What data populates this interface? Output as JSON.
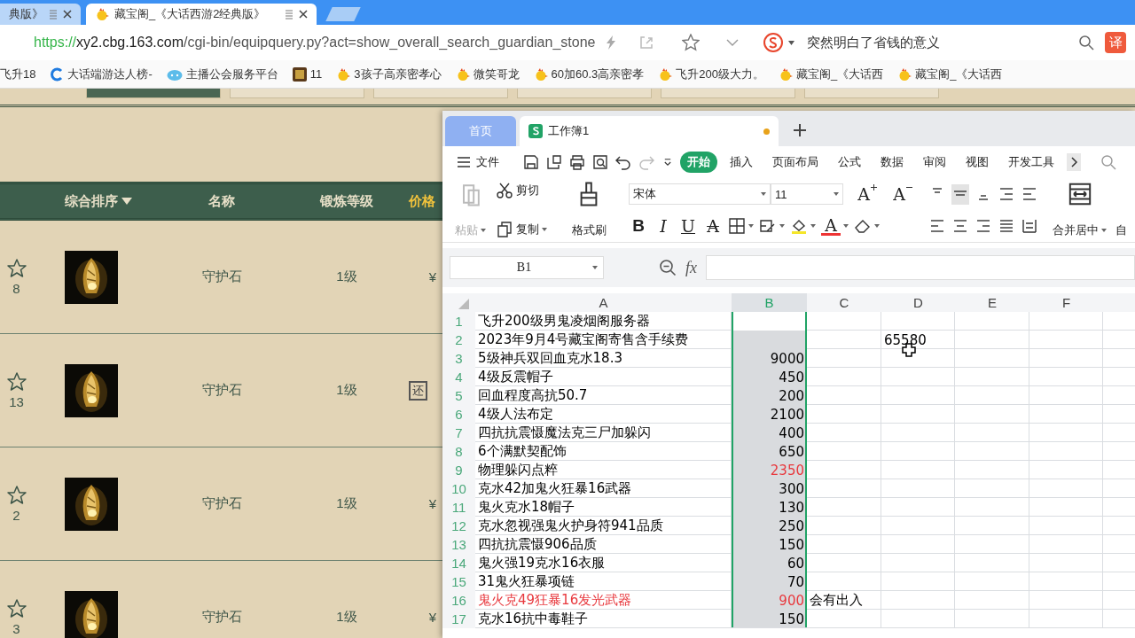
{
  "browser": {
    "tabs": [
      {
        "title": "典版》",
        "selected": false
      },
      {
        "title": "藏宝阁_《大话西游2经典版》",
        "selected": true
      }
    ],
    "address": {
      "scheme": "https://",
      "host": "xy2.cbg.163.com",
      "path": "/cgi-bin/equipquery.py?act=show_overall_search_guardian_stone"
    },
    "search": {
      "value": "突然明白了省钱的意义"
    },
    "translate_button": "译",
    "bookmarks": [
      {
        "label": "飞升18",
        "kind": "none"
      },
      {
        "label": "大话端游达人榜-",
        "kind": "c"
      },
      {
        "label": "主播公会服务平台",
        "kind": "cloud"
      },
      {
        "label": "11",
        "kind": "game"
      },
      {
        "label": "3孩子高亲密孝心",
        "kind": "chick"
      },
      {
        "label": "微笑哥龙",
        "kind": "chick"
      },
      {
        "label": "60加60.3高亲密孝",
        "kind": "chick"
      },
      {
        "label": "飞升200级大力。",
        "kind": "chick"
      },
      {
        "label": "藏宝阁_《大话西",
        "kind": "chick"
      },
      {
        "label": "藏宝阁_《大话西",
        "kind": "chick"
      }
    ]
  },
  "page": {
    "filter_buttons": [
      {
        "selected": true
      },
      {
        "selected": false
      },
      {
        "selected": false
      },
      {
        "selected": false
      },
      {
        "selected": false
      },
      {
        "selected": false
      }
    ],
    "columns": [
      {
        "label": "综合排序",
        "kind": "sort"
      },
      {
        "label": "名称",
        "kind": "plain"
      },
      {
        "label": "锻炼等级",
        "kind": "plain"
      },
      {
        "label": "价格",
        "kind": "price"
      }
    ],
    "items": [
      {
        "favorites": "8",
        "favorited": false,
        "name": "守护石",
        "level": "1级",
        "price": "¥"
      },
      {
        "favorites": "13",
        "favorited": false,
        "name": "守护石",
        "level": "1级",
        "badge": "还"
      },
      {
        "favorites": "2",
        "favorited": false,
        "name": "守护石",
        "level": "1级",
        "price": "¥"
      },
      {
        "favorites": "3",
        "favorited": false,
        "name": "守护石",
        "level": "1级",
        "price": "¥"
      }
    ]
  },
  "spreadsheet": {
    "tabs": [
      {
        "label": "首页",
        "kind": "home",
        "selected": false
      },
      {
        "label": "工作簿1",
        "kind": "workbook",
        "selected": true,
        "unsaved": true
      }
    ],
    "file_menu": "文件",
    "ribbon_tabs": [
      {
        "label": "开始",
        "selected": true
      },
      {
        "label": "插入",
        "selected": false
      },
      {
        "label": "页面布局",
        "selected": false
      },
      {
        "label": "公式",
        "selected": false
      },
      {
        "label": "数据",
        "selected": false
      },
      {
        "label": "审阅",
        "selected": false
      },
      {
        "label": "视图",
        "selected": false
      },
      {
        "label": "开发工具",
        "selected": false
      }
    ],
    "paste": {
      "label": "粘贴",
      "disabled": true
    },
    "cut": "剪切",
    "copy": "复制",
    "format_painter": "格式刷",
    "font": "宋体",
    "font_size": "11",
    "font_grow": "A",
    "font_shrink": "A",
    "format_glyphs": [
      {
        "glyph": "B",
        "kind": "bold"
      },
      {
        "glyph": "I",
        "kind": "italic"
      },
      {
        "glyph": "U",
        "kind": "underline"
      },
      {
        "glyph": "A",
        "kind": "strike"
      }
    ],
    "font_color": "A",
    "merge": "合并居中",
    "next_group": "自",
    "name_box": "B1",
    "fx": "fx",
    "columns": [
      {
        "label": "A",
        "selected": false
      },
      {
        "label": "B",
        "selected": true
      },
      {
        "label": "C",
        "selected": false
      },
      {
        "label": "D",
        "selected": false
      },
      {
        "label": "E",
        "selected": false
      },
      {
        "label": "F",
        "selected": false
      }
    ],
    "rows": [
      {
        "number": "1",
        "a": {
          "text": "飞升200级男鬼凌烟阁服务器",
          "color": "#000000"
        }
      },
      {
        "number": "2",
        "a": {
          "text": "2023年9月4号藏宝阁寄售含手续费",
          "color": "#000000"
        },
        "d": {
          "text": "65580",
          "color": "#000000"
        }
      },
      {
        "number": "3",
        "a": {
          "text": "5级神兵双回血克水18.3",
          "color": "#000000"
        },
        "b": {
          "text": "9000",
          "color": "#000000"
        }
      },
      {
        "number": "4",
        "a": {
          "text": "4级反震帽子",
          "color": "#000000"
        },
        "b": {
          "text": "450",
          "color": "#000000"
        }
      },
      {
        "number": "5",
        "a": {
          "text": "回血程度高抗50.7",
          "color": "#000000"
        },
        "b": {
          "text": "200",
          "color": "#000000"
        }
      },
      {
        "number": "6",
        "a": {
          "text": "4级人法布定",
          "color": "#000000"
        },
        "b": {
          "text": "2100",
          "color": "#000000"
        }
      },
      {
        "number": "7",
        "a": {
          "text": "四抗抗震慑魔法克三尸加躲闪",
          "color": "#000000"
        },
        "b": {
          "text": "400",
          "color": "#000000"
        }
      },
      {
        "number": "8",
        "a": {
          "text": "6个满默契配饰",
          "color": "#000000"
        },
        "b": {
          "text": "650",
          "color": "#000000"
        }
      },
      {
        "number": "9",
        "a": {
          "text": "物理躲闪点粹",
          "color": "#000000"
        },
        "b": {
          "text": "2350",
          "color": "#e8383d"
        }
      },
      {
        "number": "10",
        "a": {
          "text": "克水42加鬼火狂暴16武器",
          "color": "#000000"
        },
        "b": {
          "text": "300",
          "color": "#000000"
        }
      },
      {
        "number": "11",
        "a": {
          "text": "鬼火克水18帽子",
          "color": "#000000"
        },
        "b": {
          "text": "130",
          "color": "#000000"
        }
      },
      {
        "number": "12",
        "a": {
          "text": "克水忽视强鬼火护身符941品质",
          "color": "#000000"
        },
        "b": {
          "text": "250",
          "color": "#000000"
        }
      },
      {
        "number": "13",
        "a": {
          "text": "四抗抗震慑906品质",
          "color": "#000000"
        },
        "b": {
          "text": "150",
          "color": "#000000"
        }
      },
      {
        "number": "14",
        "a": {
          "text": "鬼火强19克水16衣服",
          "color": "#000000"
        },
        "b": {
          "text": "60",
          "color": "#000000"
        }
      },
      {
        "number": "15",
        "a": {
          "text": "31鬼火狂暴项链",
          "color": "#000000"
        },
        "b": {
          "text": "70",
          "color": "#000000"
        }
      },
      {
        "number": "16",
        "a": {
          "text": "鬼火克49狂暴16发光武器",
          "color": "#e8383d"
        },
        "b": {
          "text": "900",
          "color": "#e8383d"
        },
        "c": {
          "text": "会有出入",
          "color": "#000000"
        }
      },
      {
        "number": "17",
        "a": {
          "text": "克水16抗中毒鞋子",
          "color": "#000000"
        },
        "b": {
          "text": "150",
          "color": "#000000"
        }
      }
    ]
  }
}
